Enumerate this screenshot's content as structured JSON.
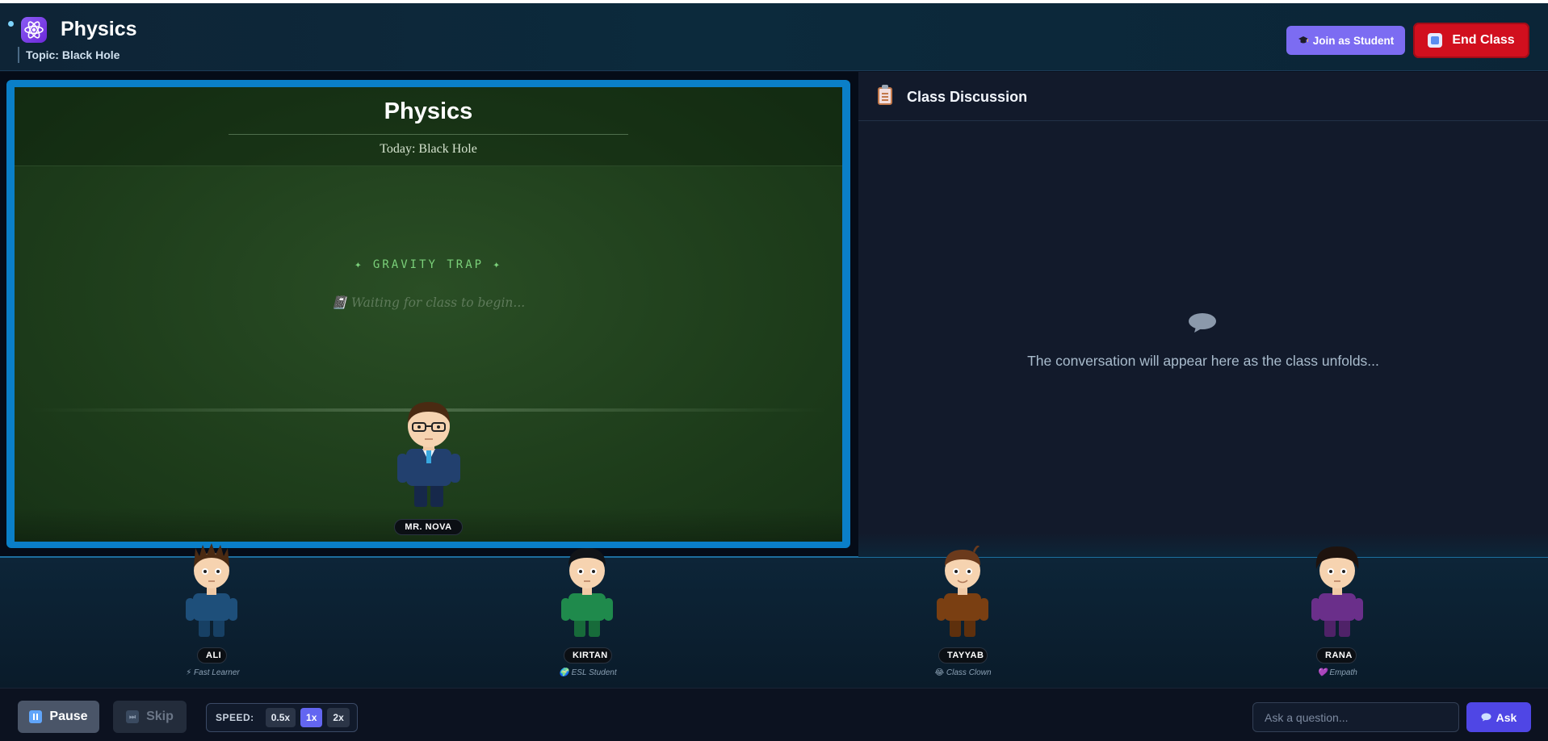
{
  "header": {
    "app_title": "Physics",
    "topic": "Topic: Black Hole",
    "join_label": "Join as Student",
    "end_label": "End Class"
  },
  "board": {
    "title": "Physics",
    "subtitle": "Today: Black Hole",
    "tagline": "✦ GRAVITY TRAP ✦",
    "status": "📓 Waiting for class to begin..."
  },
  "teacher": {
    "name": "MR. NOVA"
  },
  "discussion": {
    "title": "Class Discussion",
    "empty_message": "The conversation will appear here as the class unfolds..."
  },
  "students": [
    {
      "name": "ALI",
      "role": "⚡ Fast Learner",
      "shirt": "#1e4f7a",
      "hair": "#4a2a12"
    },
    {
      "name": "KIRTAN",
      "role": "🌍 ESL Student",
      "shirt": "#1f8a4c",
      "hair": "#111418"
    },
    {
      "name": "TAYYAB",
      "role": "😂 Class Clown",
      "shirt": "#7a3f12",
      "hair": "#6b3a1c"
    },
    {
      "name": "RANA",
      "role": "💜 Empath",
      "shirt": "#6a2f8a",
      "hair": "#1e130e"
    }
  ],
  "controls": {
    "pause_label": "Pause",
    "skip_label": "Skip",
    "speed_label": "SPEED:",
    "speed_options": [
      "0.5x",
      "1x",
      "2x"
    ],
    "speed_selected": "1x",
    "ask_placeholder": "Ask a question...",
    "ask_value": "",
    "ask_label": "Ask"
  },
  "colors": {
    "accent": "#6366f1",
    "danger": "#d10f1e",
    "board_frame": "#0a7fc8",
    "chalkboard": "#1e3d1b"
  },
  "icons": {
    "logo": "atom-icon",
    "join": "graduation-cap-icon",
    "end": "stop-icon",
    "discussion": "clipboard-icon",
    "empty": "speech-bubble-icon",
    "pause": "pause-icon",
    "skip": "skip-icon",
    "ask": "chat-icon"
  }
}
